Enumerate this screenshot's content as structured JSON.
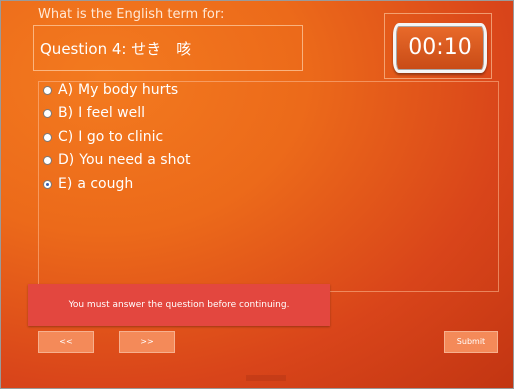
{
  "quiz": {
    "prompt": "What is the English term for:",
    "question": "Question 4:  せき　咳",
    "timer": "00:10"
  },
  "options": [
    {
      "letter": "A)",
      "text": "My body hurts",
      "selected": false
    },
    {
      "letter": "B)",
      "text": "I feel well",
      "selected": false
    },
    {
      "letter": "C)",
      "text": "I go to clinic",
      "selected": false
    },
    {
      "letter": "D)",
      "text": "You need a shot",
      "selected": false
    },
    {
      "letter": "E)",
      "text": "a cough",
      "selected": true
    }
  ],
  "alert": {
    "message": "You must answer the question before continuing."
  },
  "navigation": {
    "prev_label": "<<",
    "next_label": ">>",
    "submit_label": "Submit"
  },
  "colors": {
    "background_light": "#f37a1f",
    "background_dark": "#c23512",
    "alert_bg": "#e3473f",
    "button_bg": "#f48a59"
  }
}
